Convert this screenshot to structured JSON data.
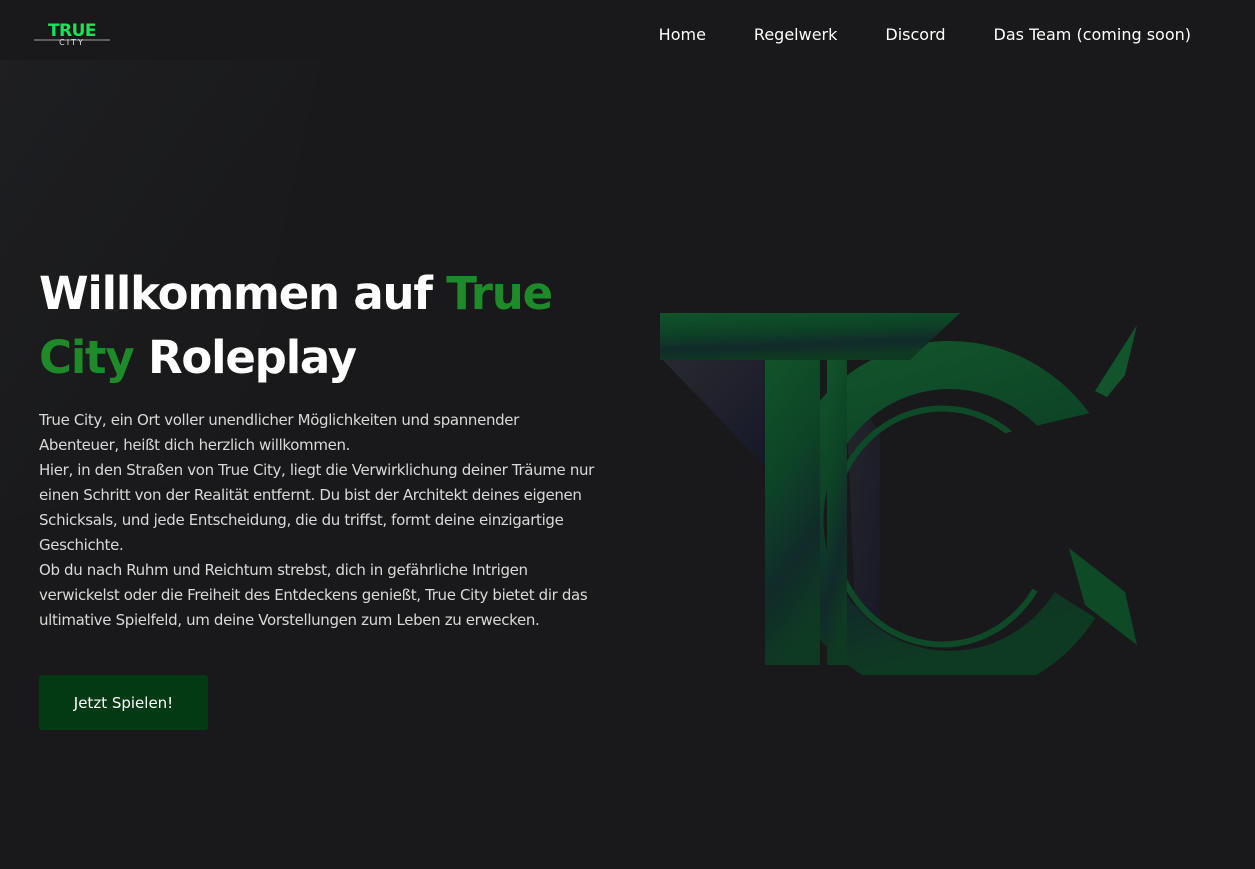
{
  "logo": {
    "top_text": "TRUE",
    "bottom_text": "CITY",
    "accent_color": "#19e35a"
  },
  "nav": {
    "items": [
      {
        "label": "Home"
      },
      {
        "label": "Regelwerk"
      },
      {
        "label": "Discord"
      },
      {
        "label": "Das Team (coming soon)"
      }
    ]
  },
  "hero": {
    "title_part1": "Willkommen auf ",
    "title_accent": "True City",
    "title_part2": " Roleplay",
    "paragraphs": [
      "True City, ein Ort voller unendlicher Möglichkeiten und spannender Abenteuer, heißt dich herzlich willkommen.",
      "Hier, in den Straßen von True City, liegt die Verwirklichung deiner Träume nur einen Schritt von der Realität entfernt. Du bist der Architekt deines eigenen Schicksals, und jede Entscheidung, die du triffst, formt deine einzigartige Geschichte.",
      "Ob du nach Ruhm und Reichtum strebst, dich in gefährliche Intrigen verwickelst oder die Freiheit des Entdeckens genießt, True City bietet dir das ultimative Spielfeld, um deine Vorstellungen zum Leben zu erwecken."
    ],
    "cta_label": "Jetzt Spielen!"
  },
  "colors": {
    "background": "#19191b",
    "accent": "#1f8a2a",
    "button": "#033a14",
    "logo_green": "#0f5a2c"
  }
}
